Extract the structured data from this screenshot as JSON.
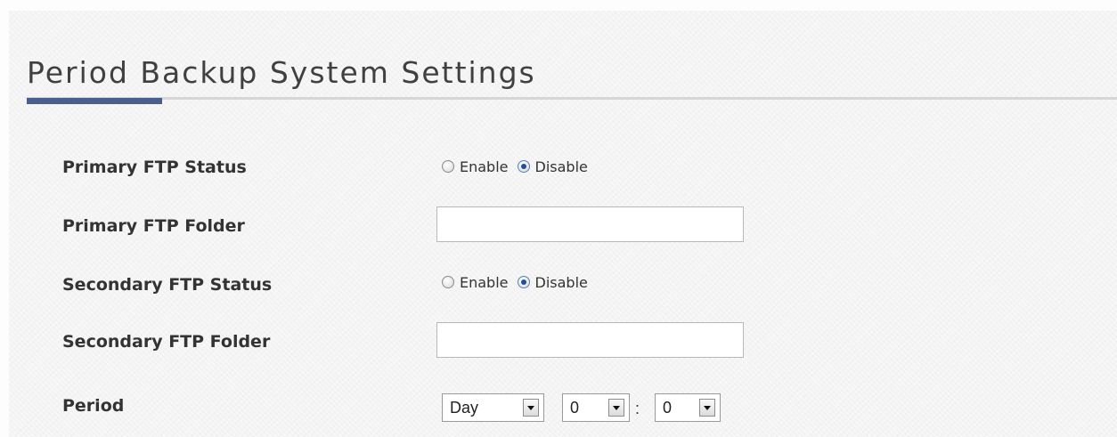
{
  "page": {
    "title": "Period Backup System Settings"
  },
  "form": {
    "primary_ftp_status": {
      "label": "Primary FTP Status",
      "options": [
        "Enable",
        "Disable"
      ],
      "selected": "Disable"
    },
    "primary_ftp_folder": {
      "label": "Primary FTP Folder",
      "value": ""
    },
    "secondary_ftp_status": {
      "label": "Secondary FTP Status",
      "options": [
        "Enable",
        "Disable"
      ],
      "selected": "Disable"
    },
    "secondary_ftp_folder": {
      "label": "Secondary FTP Folder",
      "value": ""
    },
    "period": {
      "label": "Period",
      "frequency": "Day",
      "hour": "0",
      "separator": ":",
      "minute": "0"
    }
  },
  "colors": {
    "accent": "#4a5f8f",
    "radio_checked": "#1d4f9a"
  }
}
